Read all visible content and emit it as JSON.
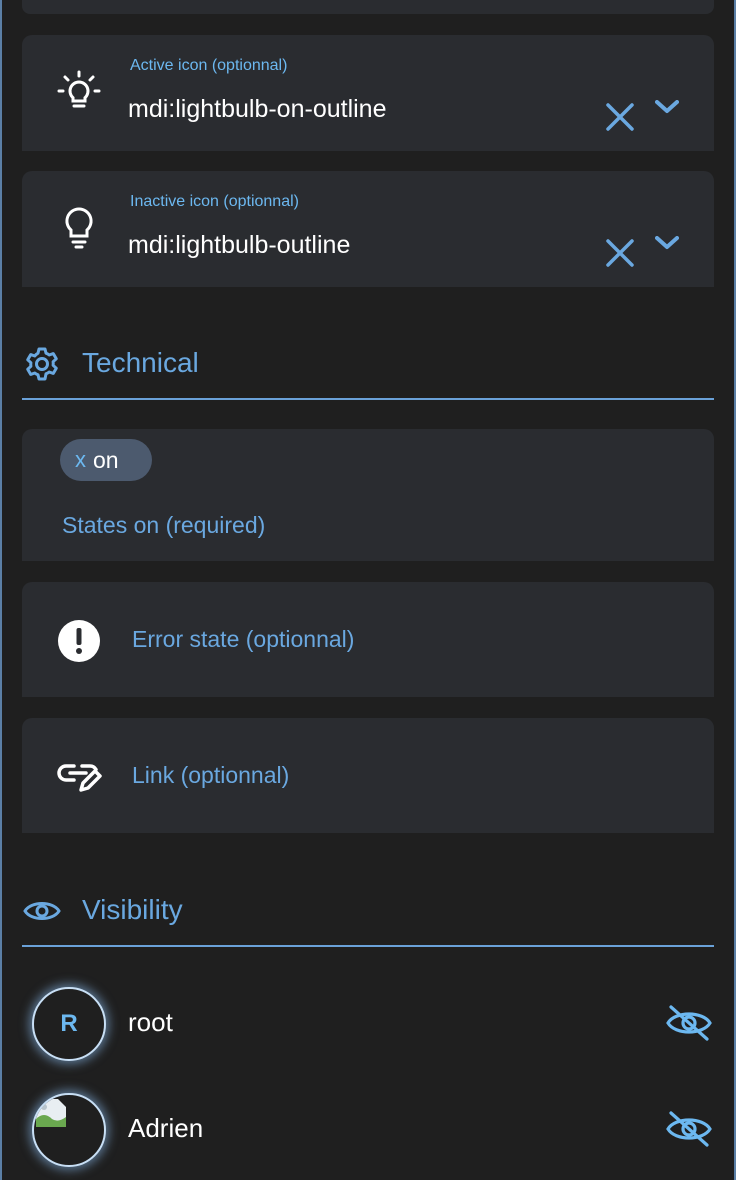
{
  "colors": {
    "background": "#1f1f1f",
    "card": "#2a2c30",
    "accent": "#6aa8e0",
    "label_light_blue": "#6cb8f0",
    "chip_bg": "#4c5a6e"
  },
  "active_icon_field": {
    "icon": "lightbulb-on-outline-icon",
    "label": "Active icon (optionnal)",
    "value": "mdi:lightbulb-on-outline"
  },
  "inactive_icon_field": {
    "icon": "lightbulb-outline-icon",
    "label": "Inactive icon (optionnal)",
    "value": "mdi:lightbulb-outline"
  },
  "technical": {
    "icon": "gear-icon",
    "title": "Technical",
    "states_on": {
      "chips": [
        {
          "remove": "x",
          "text": "on"
        }
      ],
      "label": "States on (required)"
    },
    "error_state": {
      "icon": "alert-circle-icon",
      "label": "Error state (optionnal)"
    },
    "link": {
      "icon": "link-edit-icon",
      "label": "Link (optionnal)"
    }
  },
  "visibility": {
    "icon": "eye-icon",
    "title": "Visibility",
    "users": [
      {
        "initial": "R",
        "name": "root",
        "toggle_icon": "eye-off-icon"
      },
      {
        "initial": "",
        "name": "Adrien",
        "toggle_icon": "eye-off-icon"
      }
    ]
  }
}
